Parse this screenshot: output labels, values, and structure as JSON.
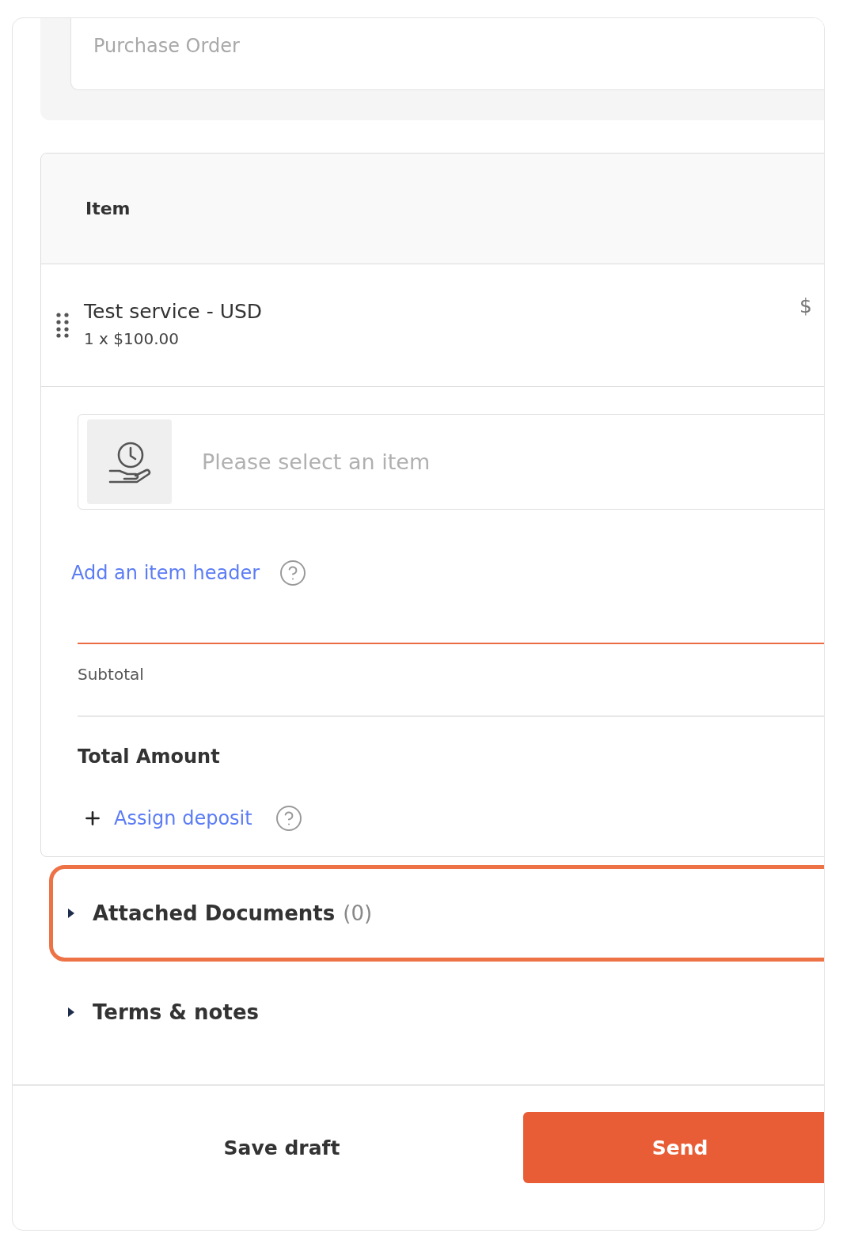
{
  "purchase_order": {
    "placeholder": "Purchase Order"
  },
  "items_table": {
    "header": "Item",
    "rows": [
      {
        "title": "Test service - USD",
        "detail": "1 x $100.00",
        "price": "$"
      }
    ],
    "item_select": {
      "placeholder": "Please select an item"
    },
    "add_header_link": "Add an item header",
    "subtotal_label": "Subtotal",
    "total_label": "Total Amount",
    "assign_deposit": "Assign deposit"
  },
  "sections": [
    {
      "title": "Attached Documents",
      "count": "(0)",
      "expanded": false,
      "highlighted": true
    },
    {
      "title": "Terms & notes",
      "expanded": false,
      "highlighted": false
    }
  ],
  "footer": {
    "buttons": [
      {
        "label": "Save draft",
        "kind": "secondary"
      },
      {
        "label": "Send",
        "kind": "primary"
      }
    ]
  }
}
